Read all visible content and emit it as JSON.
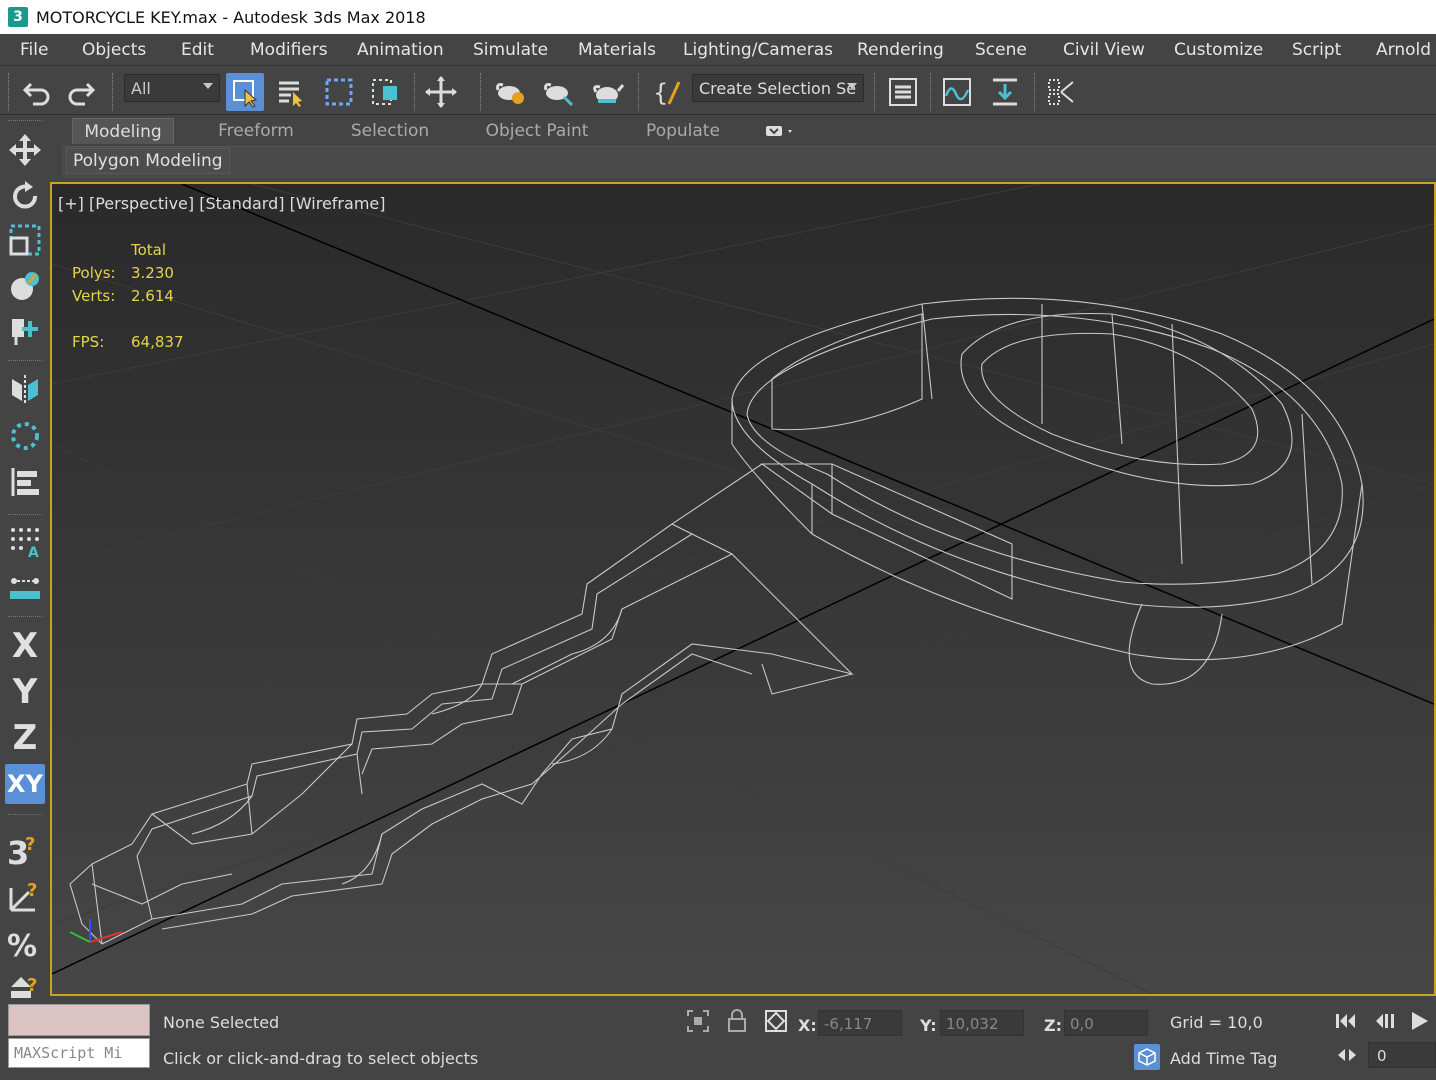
{
  "window": {
    "title": "MOTORCYCLE KEY.max - Autodesk 3ds Max 2018",
    "app_icon": "3"
  },
  "menu": [
    "File",
    "Objects",
    "Edit",
    "Modifiers",
    "Animation",
    "Simulate",
    "Materials",
    "Lighting/Cameras",
    "Rendering",
    "Scene",
    "Civil View",
    "Customize",
    "Script",
    "Arnold"
  ],
  "toolbar": {
    "filter_value": "All",
    "selection_set_value": "Create Selection Se",
    "buttons": [
      "undo-icon",
      "redo-icon",
      "select-object-icon",
      "select-by-name-icon",
      "rectangular-region-icon",
      "window-crossing-icon",
      "select-move-icon",
      "render-setup-icon",
      "rendered-frame-icon",
      "render-teapot-icon",
      "edit-named-sets-icon",
      "layer-explorer-icon",
      "curve-editor-icon",
      "schematic-view-icon",
      "mirror-icon"
    ]
  },
  "ribbon": {
    "tabs": [
      "Modeling",
      "Freeform",
      "Selection",
      "Object Paint",
      "Populate"
    ],
    "active_tab": "Modeling",
    "panel_button": "Polygon Modeling"
  },
  "leftbar": {
    "tools": [
      "move-icon",
      "rotate-icon",
      "scale-icon",
      "place-icon",
      "pivot-icon",
      "mirror-icon",
      "array-icon",
      "align-icon",
      "snap-icon",
      "measure-icon"
    ],
    "axes": [
      "X",
      "Y",
      "Z",
      "XY"
    ],
    "active_axis": "XY"
  },
  "viewport": {
    "label": "[+] [Perspective] [Standard] [Wireframe]",
    "stats": {
      "header": "Total",
      "polys_label": "Polys:",
      "polys_value": "3.230",
      "verts_label": "Verts:",
      "verts_value": "2.614",
      "fps_label": "FPS:",
      "fps_value": "64,837"
    },
    "border_color": "#c9a227"
  },
  "status": {
    "maxscript_placeholder": "MAXScript Mi",
    "selection": "None Selected",
    "prompt": "Click or click-and-drag to select objects",
    "x_label": "X:",
    "x_value": "-6,117",
    "y_label": "Y:",
    "y_value": "10,032",
    "z_label": "Z:",
    "z_value": "0,0",
    "grid": "Grid = 10,0",
    "add_time_tag": "Add Time Tag",
    "frame": "0"
  },
  "colors": {
    "accent": "#5b8fd6",
    "stats": "#e5d44a",
    "wire": "#c8c8c8"
  }
}
